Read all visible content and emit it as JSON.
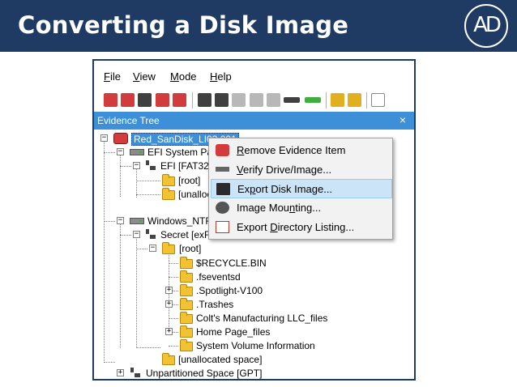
{
  "slide": {
    "title": "Converting a Disk Image",
    "logo_text": "AD"
  },
  "menu": [
    {
      "pre": "",
      "u": "F",
      "post": "ile"
    },
    {
      "pre": "",
      "u": "V",
      "post": "iew"
    },
    {
      "pre": "",
      "u": "M",
      "post": "ode"
    },
    {
      "pre": "",
      "u": "H",
      "post": "elp"
    }
  ],
  "toolbar": {
    "icons": [
      "add-evidence-icon",
      "add-all-images-icon",
      "image-mounting-icon",
      "remove-evidence-icon",
      "remove-all-icon",
      "create-image-icon",
      "export-image-icon",
      "disabled-image-icon",
      "printer-icon",
      "printer-alt-icon",
      "drive-icon",
      "status-bar-icon",
      "obtain-protected-files-icon",
      "key-icon",
      "document-icon"
    ],
    "colors": {
      "red": "#d23c3c",
      "dark": "#404040",
      "gray": "#b8b8b8",
      "yellow": "#e0b020",
      "green": "#3fae3f"
    }
  },
  "evidence_tree": {
    "title": "Evidence Tree",
    "close": "×",
    "nodes": [
      {
        "label": "Red_SanDisk_LI03.001",
        "icon": "evidence-icon",
        "expander": "−",
        "selected": true
      },
      {
        "label": "EFI System Part",
        "icon": "drive-icon",
        "expander": "−"
      },
      {
        "label": "EFI [FAT32",
        "icon": "partition-icon",
        "expander": "−"
      },
      {
        "label": "[root]",
        "icon": "folder-icon",
        "expander": ""
      },
      {
        "label": "[unalloc",
        "icon": "folder-icon",
        "expander": ""
      },
      {
        "label": "Windows_NTF",
        "icon": "drive-icon",
        "expander": "−"
      },
      {
        "label": "Secret [exF",
        "icon": "partition-icon",
        "expander": "−"
      },
      {
        "label": "[root]",
        "icon": "folder-icon",
        "expander": "−"
      },
      {
        "label": "$RECYCLE.BIN",
        "icon": "folder-icon",
        "expander": ""
      },
      {
        "label": ".fseventsd",
        "icon": "folder-icon",
        "expander": ""
      },
      {
        "label": ".Spotlight-V100",
        "icon": "folder-icon",
        "expander": "+"
      },
      {
        "label": ".Trashes",
        "icon": "folder-icon",
        "expander": "+"
      },
      {
        "label": "Colt's Manufacturing LLC_files",
        "icon": "folder-icon",
        "expander": ""
      },
      {
        "label": "Home Page_files",
        "icon": "folder-icon",
        "expander": "+"
      },
      {
        "label": "System Volume Information",
        "icon": "folder-icon",
        "expander": ""
      },
      {
        "label": "[unallocated space]",
        "icon": "folder-icon",
        "expander": ""
      },
      {
        "label": "Unpartitioned Space [GPT]",
        "icon": "partition-icon",
        "expander": "+"
      }
    ]
  },
  "context_menu": {
    "items": [
      {
        "pre": "",
        "u": "R",
        "post": "emove Evidence Item",
        "icon": "remove-evidence-icon",
        "icon_color": "#d23c3c"
      },
      {
        "pre": "",
        "u": "V",
        "post": "erify Drive/Image...",
        "icon": "verify-drive-icon",
        "icon_color": "#666666"
      },
      {
        "pre": "Ex",
        "u": "p",
        "post": "ort Disk Image...",
        "icon": "floppy-disk-icon",
        "icon_color": "#2b2b2b",
        "highlighted": true
      },
      {
        "pre": "Image Mou",
        "u": "n",
        "post": "ting...",
        "icon": "image-mounting-icon",
        "icon_color": "#555555"
      },
      {
        "pre": "Export ",
        "u": "D",
        "post": "irectory Listing...",
        "icon": "directory-listing-icon",
        "icon_color": "#b33b2e"
      }
    ]
  }
}
